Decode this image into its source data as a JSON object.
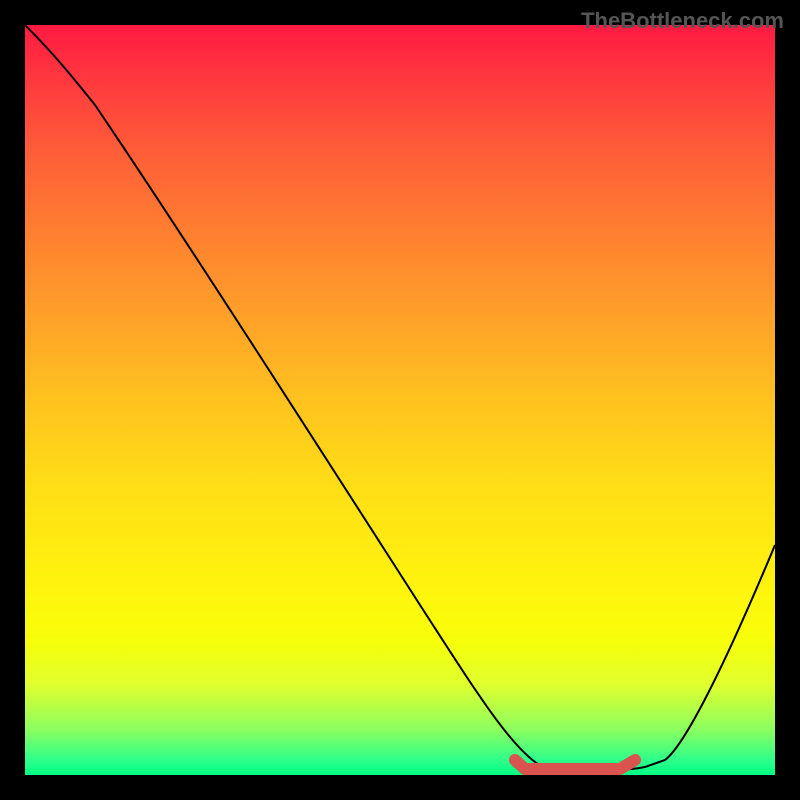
{
  "watermark": "TheBottleneck.com",
  "chart_data": {
    "type": "line",
    "title": "",
    "xlabel": "",
    "ylabel": "",
    "x": [
      0,
      5,
      10,
      15,
      20,
      25,
      30,
      35,
      40,
      45,
      50,
      55,
      60,
      65,
      70,
      72,
      75,
      80,
      85,
      90,
      95,
      100
    ],
    "values": [
      100,
      95,
      90,
      83,
      75,
      67,
      59,
      51,
      44,
      37,
      30,
      23,
      16,
      9,
      3,
      0,
      0,
      0,
      3,
      12,
      25,
      40
    ],
    "ylim": [
      0,
      100
    ],
    "xlim": [
      0,
      100
    ],
    "marker_range": {
      "x_start": 65,
      "x_end": 82,
      "y": 0
    },
    "gradient_stops": [
      "#ff1a42",
      "#ff9e2a",
      "#fff20e",
      "#00ff84"
    ]
  }
}
